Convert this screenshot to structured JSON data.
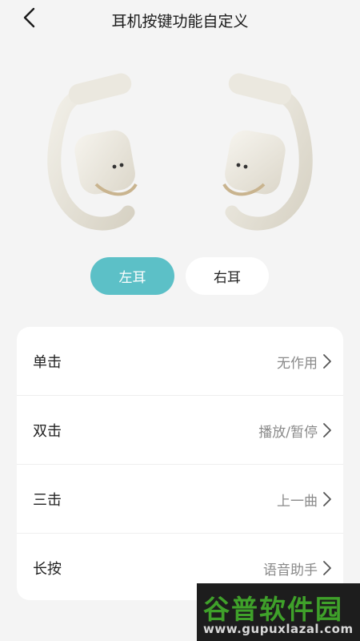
{
  "header": {
    "title": "耳机按键功能自定义"
  },
  "ear_tabs": {
    "left": "左耳",
    "right": "右耳",
    "selected": "left"
  },
  "settings": [
    {
      "label": "单击",
      "value": "无作用"
    },
    {
      "label": "双击",
      "value": "播放/暂停"
    },
    {
      "label": "三击",
      "value": "上一曲"
    },
    {
      "label": "长按",
      "value": "语音助手"
    }
  ],
  "watermark": {
    "brand": "谷普软件园",
    "url": "www.gupuxlazal.com"
  },
  "colors": {
    "accent": "#5cc0c7",
    "background": "#f4f4f4",
    "card": "#ffffff"
  }
}
